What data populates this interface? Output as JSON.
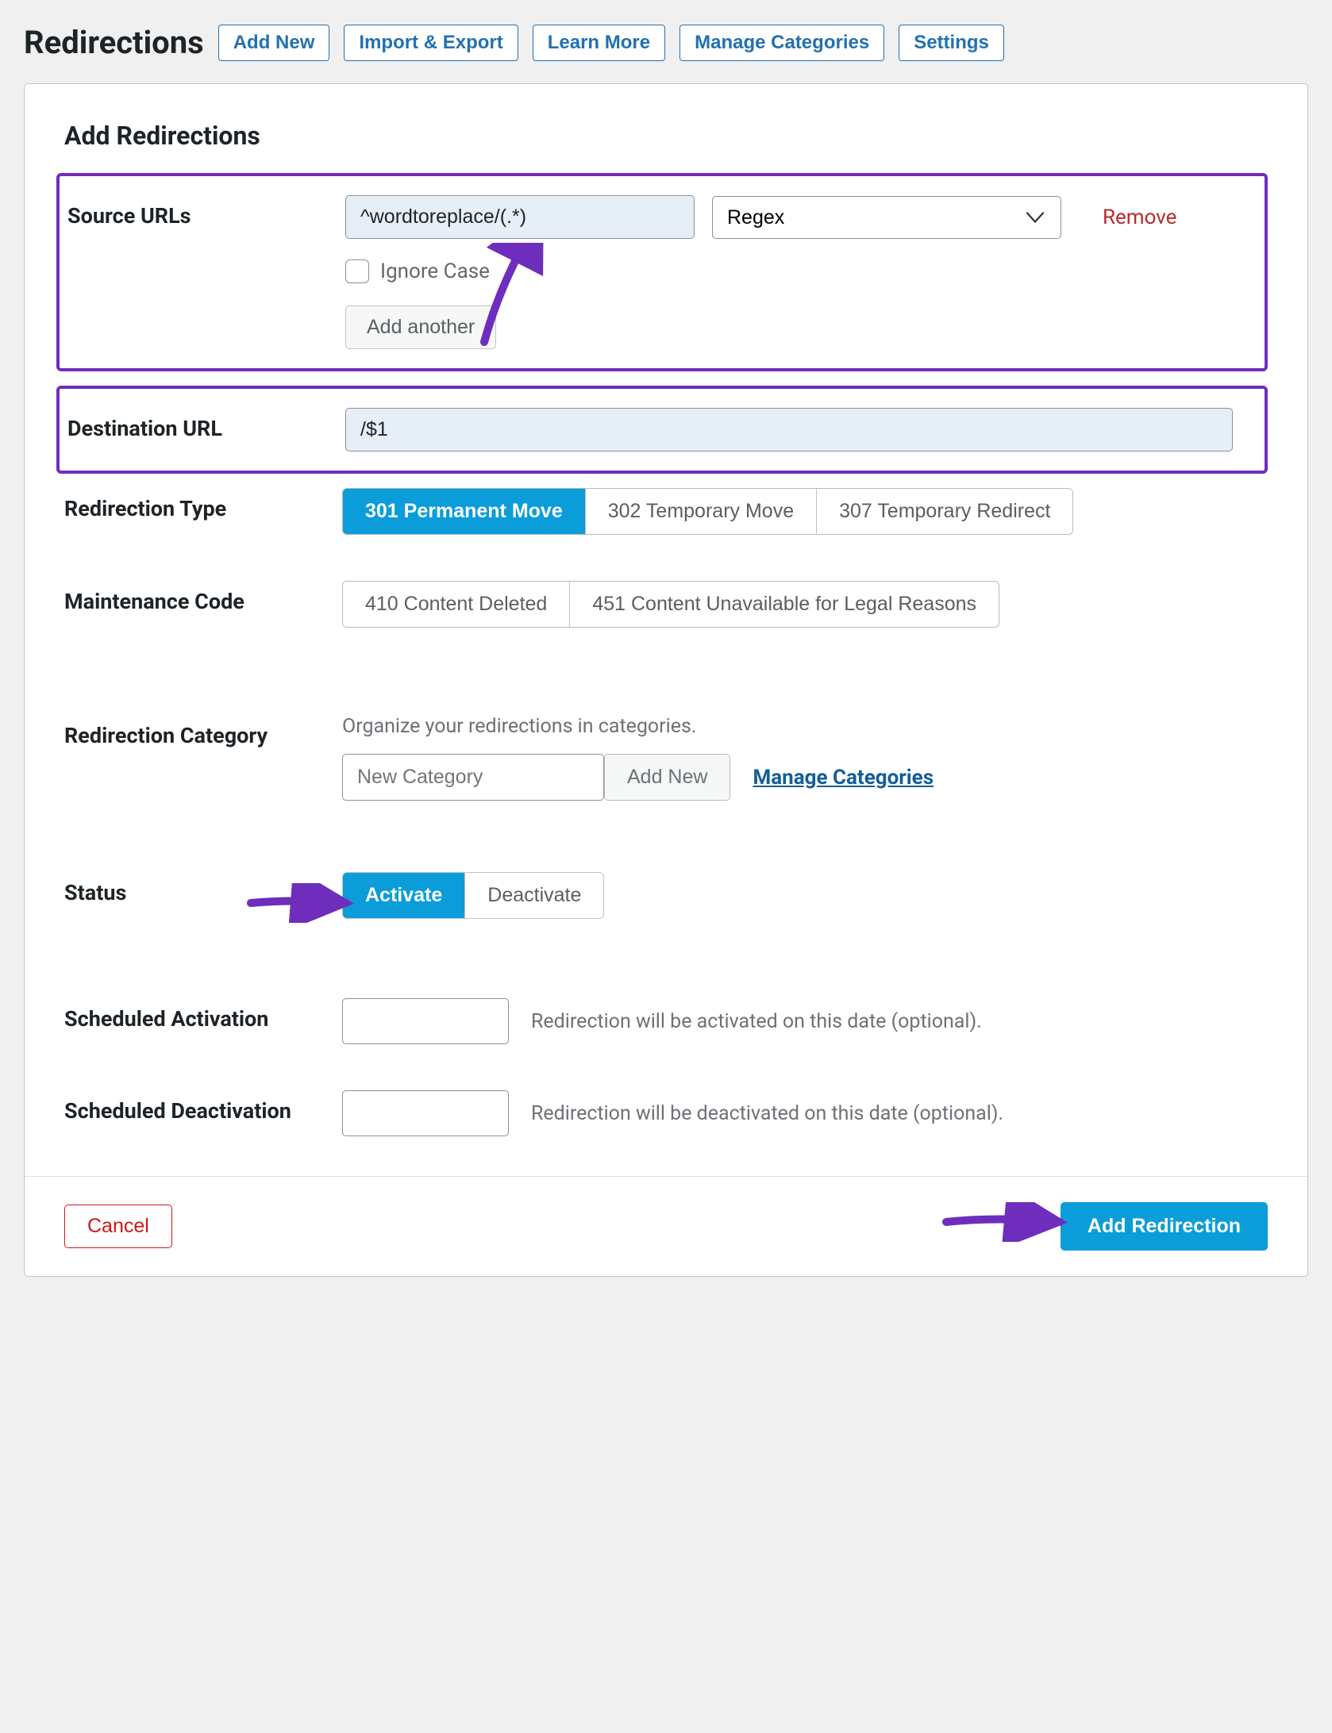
{
  "header": {
    "title": "Redirections",
    "buttons": [
      "Add New",
      "Import & Export",
      "Learn More",
      "Manage Categories",
      "Settings"
    ]
  },
  "panel": {
    "title": "Add Redirections"
  },
  "source": {
    "label": "Source URLs",
    "value": "^wordtoreplace/(.*)",
    "match_type": "Regex",
    "remove": "Remove",
    "ignore_case": "Ignore Case",
    "add_another": "Add another"
  },
  "destination": {
    "label": "Destination URL",
    "value": "/$1"
  },
  "redir_type": {
    "label": "Redirection Type",
    "options": [
      "301 Permanent Move",
      "302 Temporary Move",
      "307 Temporary Redirect"
    ],
    "selected": 0
  },
  "maintenance": {
    "label": "Maintenance Code",
    "options": [
      "410 Content Deleted",
      "451 Content Unavailable for Legal Reasons"
    ]
  },
  "category": {
    "label": "Redirection Category",
    "help": "Organize your redirections in categories.",
    "placeholder": "New Category",
    "add_btn": "Add New",
    "manage_link": "Manage Categories"
  },
  "status": {
    "label": "Status",
    "options": [
      "Activate",
      "Deactivate"
    ],
    "selected": 0
  },
  "sched_act": {
    "label": "Scheduled Activation",
    "hint": "Redirection will be activated on this date (optional)."
  },
  "sched_deact": {
    "label": "Scheduled Deactivation",
    "hint": "Redirection will be deactivated on this date (optional)."
  },
  "footer": {
    "cancel": "Cancel",
    "submit": "Add Redirection"
  }
}
